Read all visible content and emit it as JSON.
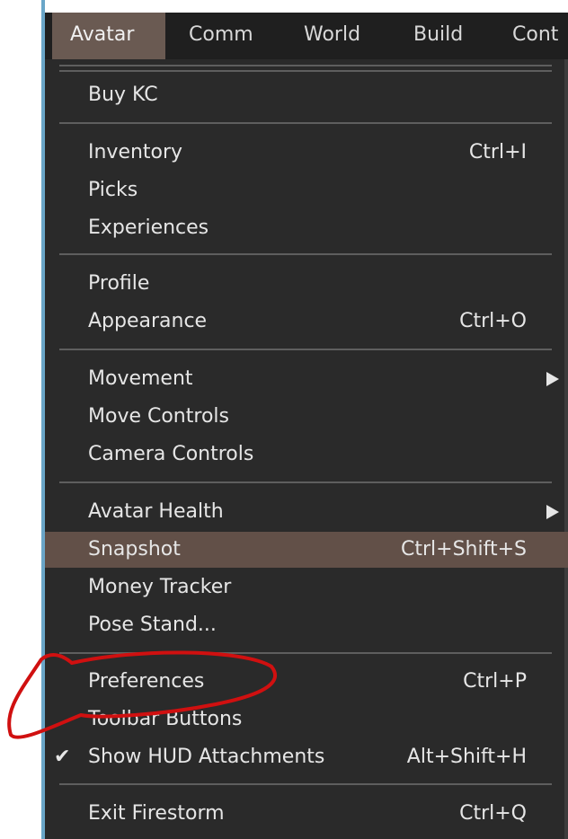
{
  "menubar": {
    "items": [
      {
        "label": "Avatar"
      },
      {
        "label": "Comm"
      },
      {
        "label": "World"
      },
      {
        "label": "Build"
      },
      {
        "label": "Cont"
      }
    ]
  },
  "menu": {
    "buy_kc": {
      "label": "Buy KC"
    },
    "inventory": {
      "label": "Inventory",
      "shortcut": "Ctrl+I"
    },
    "picks": {
      "label": "Picks"
    },
    "experiences": {
      "label": "Experiences"
    },
    "profile": {
      "label": "Profile"
    },
    "appearance": {
      "label": "Appearance",
      "shortcut": "Ctrl+O"
    },
    "movement": {
      "label": "Movement"
    },
    "move_controls": {
      "label": "Move Controls"
    },
    "camera_controls": {
      "label": "Camera Controls"
    },
    "avatar_health": {
      "label": "Avatar Health"
    },
    "snapshot": {
      "label": "Snapshot",
      "shortcut": "Ctrl+Shift+S"
    },
    "money_tracker": {
      "label": "Money Tracker"
    },
    "pose_stand": {
      "label": "Pose Stand..."
    },
    "preferences": {
      "label": "Preferences",
      "shortcut": "Ctrl+P"
    },
    "toolbar_buttons": {
      "label": "Toolbar Buttons"
    },
    "show_hud": {
      "label": "Show HUD Attachments",
      "shortcut": "Alt+Shift+H",
      "check": "✔"
    },
    "exit": {
      "label": "Exit Firestorm",
      "shortcut": "Ctrl+Q"
    }
  },
  "colors": {
    "menu_bg": "#2a2a2a",
    "highlight": "#625048",
    "annotation": "#d01010"
  }
}
